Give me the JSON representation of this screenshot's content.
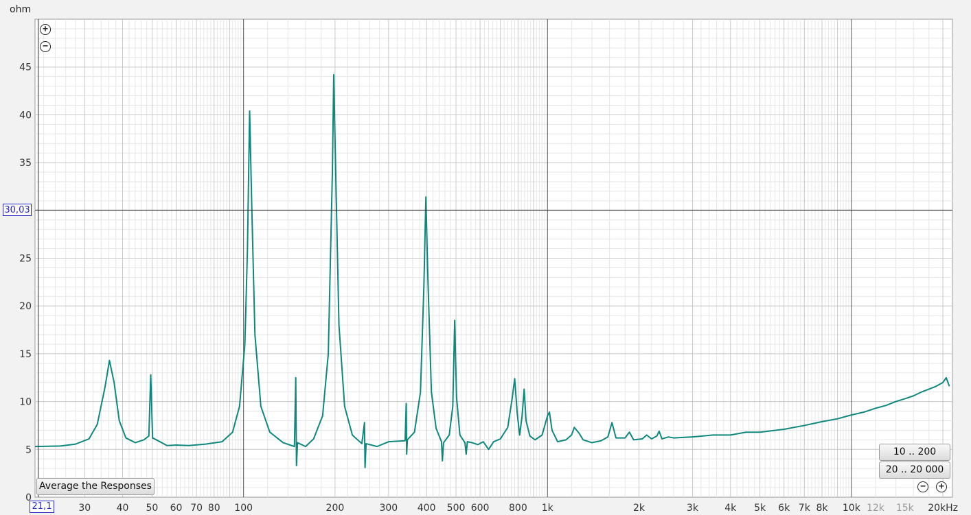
{
  "ui": {
    "y_unit": "ohm",
    "cursor_y_value": "30,03",
    "cursor_x_value": "21,1",
    "average_button": "Average the Responses",
    "range_button_1": "10 .. 200",
    "range_button_2": "20 .. 20 000",
    "zoom_in_symbol": "+",
    "zoom_out_symbol": "−"
  },
  "chart_data": {
    "type": "line",
    "title": "",
    "xlabel": "",
    "ylabel": "ohm",
    "x_scale": "log",
    "xlim": [
      20.6,
      21500
    ],
    "ylim": [
      0,
      50
    ],
    "grid": true,
    "cursor": {
      "x": 21.1,
      "y": 30.03
    },
    "y_ticks": [
      0,
      5,
      10,
      15,
      20,
      25,
      30,
      35,
      40,
      45
    ],
    "x_tick_labels": [
      {
        "v": 21.1,
        "t": "21,1",
        "dim": false,
        "hidden": true
      },
      {
        "v": 30,
        "t": "30",
        "dim": false
      },
      {
        "v": 40,
        "t": "40",
        "dim": false
      },
      {
        "v": 50,
        "t": "50",
        "dim": false
      },
      {
        "v": 60,
        "t": "60",
        "dim": false
      },
      {
        "v": 70,
        "t": "70",
        "dim": false
      },
      {
        "v": 80,
        "t": "80",
        "dim": false
      },
      {
        "v": 100,
        "t": "100",
        "dim": false
      },
      {
        "v": 200,
        "t": "200",
        "dim": false
      },
      {
        "v": 300,
        "t": "300",
        "dim": false
      },
      {
        "v": 400,
        "t": "400",
        "dim": false
      },
      {
        "v": 500,
        "t": "500",
        "dim": false
      },
      {
        "v": 600,
        "t": "600",
        "dim": false
      },
      {
        "v": 800,
        "t": "800",
        "dim": false
      },
      {
        "v": 1000,
        "t": "1k",
        "dim": false
      },
      {
        "v": 2000,
        "t": "2k",
        "dim": false
      },
      {
        "v": 3000,
        "t": "3k",
        "dim": false
      },
      {
        "v": 4000,
        "t": "4k",
        "dim": false
      },
      {
        "v": 5000,
        "t": "5k",
        "dim": false
      },
      {
        "v": 6000,
        "t": "6k",
        "dim": false
      },
      {
        "v": 7000,
        "t": "7k",
        "dim": false
      },
      {
        "v": 8000,
        "t": "8k",
        "dim": false
      },
      {
        "v": 10000,
        "t": "10k",
        "dim": false
      },
      {
        "v": 12000,
        "t": "12k",
        "dim": true
      },
      {
        "v": 15000,
        "t": "15k",
        "dim": true
      },
      {
        "v": 20000,
        "t": "20kHz",
        "dim": false
      }
    ],
    "series": [
      {
        "color": "#0e877d",
        "points": [
          [
            20.6,
            5.3
          ],
          [
            25,
            5.35
          ],
          [
            28,
            5.55
          ],
          [
            31,
            6.1
          ],
          [
            33,
            7.6
          ],
          [
            35,
            11.5
          ],
          [
            36.2,
            14.3
          ],
          [
            37.5,
            12.0
          ],
          [
            39,
            8.0
          ],
          [
            41,
            6.2
          ],
          [
            44,
            5.7
          ],
          [
            47,
            6.0
          ],
          [
            48.8,
            6.4
          ],
          [
            49.5,
            12.8
          ],
          [
            50.2,
            6.2
          ],
          [
            52,
            5.95
          ],
          [
            56,
            5.4
          ],
          [
            60,
            5.45
          ],
          [
            66,
            5.4
          ],
          [
            75,
            5.55
          ],
          [
            85,
            5.8
          ],
          [
            92,
            6.8
          ],
          [
            97,
            9.5
          ],
          [
            101,
            16.0
          ],
          [
            103,
            26.0
          ],
          [
            104.7,
            40.4
          ],
          [
            106.5,
            30.0
          ],
          [
            109,
            17.0
          ],
          [
            114,
            9.5
          ],
          [
            122,
            6.8
          ],
          [
            135,
            5.7
          ],
          [
            147,
            5.3
          ],
          [
            148.5,
            12.5
          ],
          [
            149.3,
            3.3
          ],
          [
            150.5,
            5.7
          ],
          [
            160,
            5.3
          ],
          [
            170,
            6.1
          ],
          [
            182,
            8.5
          ],
          [
            190,
            15.0
          ],
          [
            196,
            34.0
          ],
          [
            198,
            44.2
          ],
          [
            201,
            34.0
          ],
          [
            206,
            18.0
          ],
          [
            215,
            9.5
          ],
          [
            228,
            6.5
          ],
          [
            245,
            5.6
          ],
          [
            250,
            7.8
          ],
          [
            251,
            3.1
          ],
          [
            253,
            5.6
          ],
          [
            275,
            5.3
          ],
          [
            300,
            5.8
          ],
          [
            340,
            5.9
          ],
          [
            343,
            9.8
          ],
          [
            344,
            4.5
          ],
          [
            346,
            6.0
          ],
          [
            365,
            6.8
          ],
          [
            382,
            11.0
          ],
          [
            392,
            22.0
          ],
          [
            398,
            31.4
          ],
          [
            404,
            23.0
          ],
          [
            415,
            11.0
          ],
          [
            430,
            7.2
          ],
          [
            448,
            5.8
          ],
          [
            451,
            3.8
          ],
          [
            455,
            5.7
          ],
          [
            475,
            6.5
          ],
          [
            488,
            9.5
          ],
          [
            495,
            18.5
          ],
          [
            502,
            10.5
          ],
          [
            515,
            6.5
          ],
          [
            535,
            5.7
          ],
          [
            540,
            4.5
          ],
          [
            545,
            5.8
          ],
          [
            565,
            5.7
          ],
          [
            590,
            5.5
          ],
          [
            615,
            5.8
          ],
          [
            640,
            5.0
          ],
          [
            665,
            5.8
          ],
          [
            700,
            6.1
          ],
          [
            740,
            7.3
          ],
          [
            765,
            10.3
          ],
          [
            780,
            12.4
          ],
          [
            795,
            8.8
          ],
          [
            810,
            6.5
          ],
          [
            825,
            8.5
          ],
          [
            838,
            11.3
          ],
          [
            850,
            8.0
          ],
          [
            875,
            6.4
          ],
          [
            910,
            6.0
          ],
          [
            960,
            6.5
          ],
          [
            1000,
            8.5
          ],
          [
            1015,
            8.9
          ],
          [
            1035,
            7.0
          ],
          [
            1080,
            5.8
          ],
          [
            1150,
            6.0
          ],
          [
            1200,
            6.5
          ],
          [
            1225,
            7.3
          ],
          [
            1270,
            6.7
          ],
          [
            1310,
            6.0
          ],
          [
            1400,
            5.7
          ],
          [
            1500,
            5.9
          ],
          [
            1580,
            6.3
          ],
          [
            1630,
            7.8
          ],
          [
            1680,
            6.2
          ],
          [
            1800,
            6.2
          ],
          [
            1860,
            6.8
          ],
          [
            1920,
            6.0
          ],
          [
            2050,
            6.1
          ],
          [
            2120,
            6.5
          ],
          [
            2200,
            6.1
          ],
          [
            2290,
            6.4
          ],
          [
            2330,
            6.9
          ],
          [
            2380,
            6.1
          ],
          [
            2500,
            6.3
          ],
          [
            2600,
            6.2
          ],
          [
            3000,
            6.3
          ],
          [
            3500,
            6.5
          ],
          [
            4000,
            6.5
          ],
          [
            4500,
            6.8
          ],
          [
            5000,
            6.8
          ],
          [
            6000,
            7.1
          ],
          [
            7000,
            7.5
          ],
          [
            8000,
            7.9
          ],
          [
            9000,
            8.2
          ],
          [
            10000,
            8.6
          ],
          [
            11000,
            8.9
          ],
          [
            12000,
            9.3
          ],
          [
            13000,
            9.6
          ],
          [
            14000,
            10.0
          ],
          [
            15000,
            10.3
          ],
          [
            16000,
            10.6
          ],
          [
            17000,
            11.0
          ],
          [
            18000,
            11.3
          ],
          [
            19000,
            11.6
          ],
          [
            20000,
            12.0
          ],
          [
            20500,
            12.5
          ],
          [
            21000,
            11.6
          ]
        ]
      }
    ]
  }
}
